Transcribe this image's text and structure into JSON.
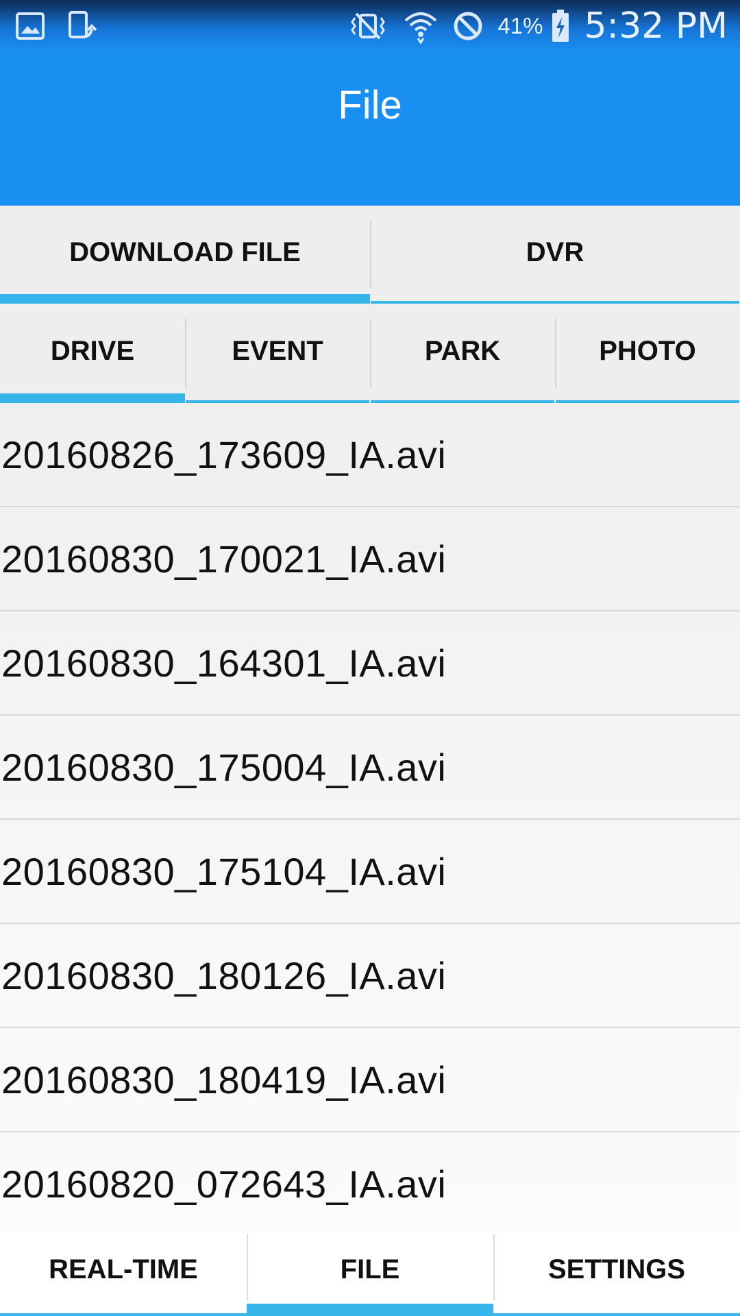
{
  "status_bar": {
    "left_icons": [
      "gallery-icon",
      "screen-rotate-icon"
    ],
    "right_icons": [
      "vibrate-mute-icon",
      "wifi-icon",
      "do-not-disturb-icon",
      "battery-charging-icon"
    ],
    "battery_percent": "41%",
    "time": "5:32 PM"
  },
  "app_bar": {
    "title": "File"
  },
  "top_tabs": [
    {
      "label": "DOWNLOAD FILE",
      "active": true
    },
    {
      "label": "DVR",
      "active": false
    }
  ],
  "sub_tabs": [
    {
      "label": "DRIVE",
      "active": true
    },
    {
      "label": "EVENT",
      "active": false
    },
    {
      "label": "PARK",
      "active": false
    },
    {
      "label": "PHOTO",
      "active": false
    }
  ],
  "files": [
    "20160826_173609_IA.avi",
    "20160830_170021_IA.avi",
    "20160830_164301_IA.avi",
    "20160830_175004_IA.avi",
    "20160830_175104_IA.avi",
    "20160830_180126_IA.avi",
    "20160830_180419_IA.avi",
    "20160820_072643_IA.avi"
  ],
  "bottom_nav": [
    {
      "label": "REAL-TIME",
      "active": false
    },
    {
      "label": "FILE",
      "active": true
    },
    {
      "label": "SETTINGS",
      "active": false
    }
  ],
  "colors": {
    "primary": "#1a8ff2",
    "accent_indicator": "#35b5ea",
    "tab_background": "#eeeeee",
    "text": "#111111"
  }
}
